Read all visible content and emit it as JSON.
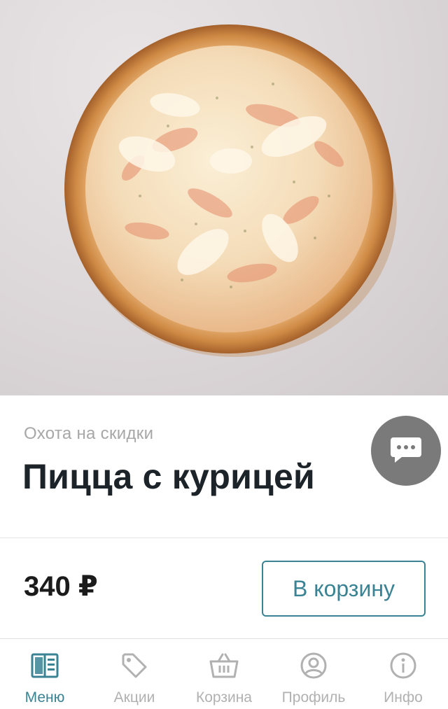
{
  "product": {
    "image_alt": "pizza-photo",
    "category": "Охота на скидки",
    "title": "Пицца с курицей",
    "price": "340 ₽",
    "add_to_cart_label": "В корзину"
  },
  "tabbar": {
    "items": [
      {
        "label": "Меню",
        "icon": "menu-book-icon",
        "active": true
      },
      {
        "label": "Акции",
        "icon": "tag-icon",
        "active": false
      },
      {
        "label": "Корзина",
        "icon": "basket-icon",
        "active": false
      },
      {
        "label": "Профиль",
        "icon": "profile-icon",
        "active": false
      },
      {
        "label": "Инфо",
        "icon": "info-icon",
        "active": false
      }
    ]
  },
  "colors": {
    "accent": "#3a8394",
    "inactive": "#b1b1b1",
    "title": "#1d2429",
    "fab": "#7a7a7a"
  }
}
